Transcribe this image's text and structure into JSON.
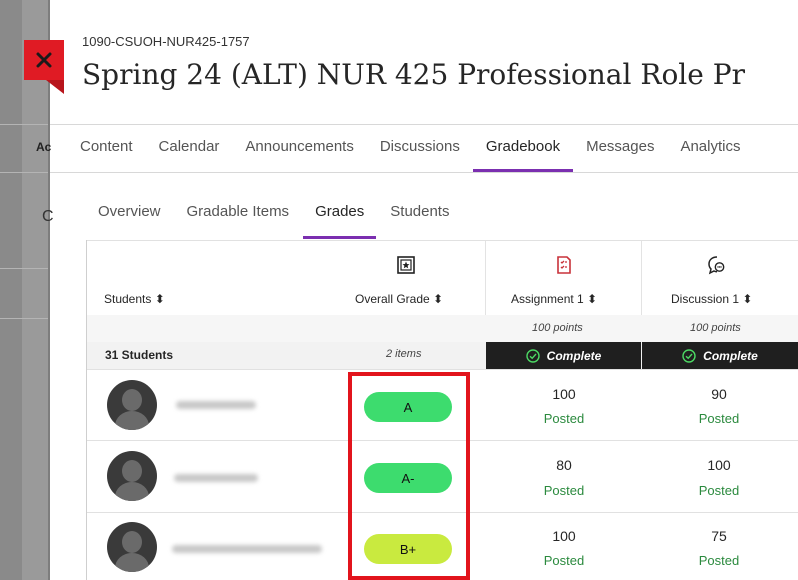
{
  "header": {
    "course_id": "1090-CSUOH-NUR425-1757",
    "course_title": "Spring 24 (ALT) NUR 425 Professional Role Pr"
  },
  "background_labels": {
    "left_tab": "Ac",
    "left_char": "C"
  },
  "main_nav": [
    {
      "label": "Content"
    },
    {
      "label": "Calendar"
    },
    {
      "label": "Announcements"
    },
    {
      "label": "Discussions"
    },
    {
      "label": "Gradebook",
      "active": true
    },
    {
      "label": "Messages"
    },
    {
      "label": "Analytics"
    }
  ],
  "sub_nav": [
    {
      "label": "Overview"
    },
    {
      "label": "Gradable Items"
    },
    {
      "label": "Grades",
      "active": true
    },
    {
      "label": "Students"
    }
  ],
  "grid": {
    "columns": {
      "students": "Students ⬍",
      "overall": "Overall Grade ⬍",
      "assignment1": "Assignment 1 ⬍",
      "discussion1": "Discussion 1 ⬍"
    },
    "points": {
      "assignment1": "100 points",
      "discussion1": "100 points"
    },
    "count_row": {
      "students_count": "31 Students",
      "overall_items": "2 items",
      "assignment1_status": "Complete",
      "discussion1_status": "Complete"
    },
    "rows": [
      {
        "grade": "A",
        "grade_color": "#3ddc6e",
        "assignment1": "100",
        "assignment1_status": "Posted",
        "discussion1": "90",
        "discussion1_status": "Posted"
      },
      {
        "grade": "A-",
        "grade_color": "#3ddc6e",
        "assignment1": "80",
        "assignment1_status": "Posted",
        "discussion1": "100",
        "discussion1_status": "Posted"
      },
      {
        "grade": "B+",
        "grade_color": "#c9ea3f",
        "assignment1": "100",
        "assignment1_status": "Posted",
        "discussion1": "75",
        "discussion1_status": "Posted"
      }
    ]
  },
  "colors": {
    "accent_purple": "#7b2fb0",
    "close_red": "#e01b24",
    "posted_green": "#2b8a3e",
    "highlight_red": "#e2141c"
  },
  "icons": {
    "close": "close-icon",
    "overall_grade": "overall-grade-icon",
    "assignment": "assignment-icon",
    "discussion": "discussion-icon",
    "complete": "check-circle-icon"
  }
}
